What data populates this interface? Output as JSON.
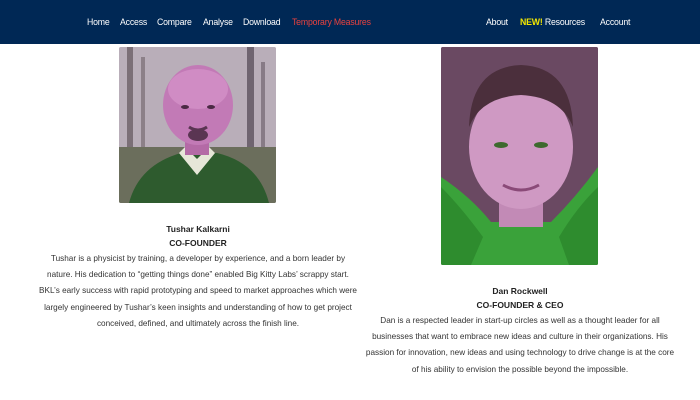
{
  "nav": {
    "left": [
      "Home",
      "Access",
      "Compare",
      "Analyse",
      "Download",
      "Temporary Measures"
    ],
    "about": "About",
    "new_badge": "NEW!",
    "resources": "Resources",
    "account": "Account"
  },
  "colors": {
    "navbar_bg": "#002855",
    "active_link": "#e8423f",
    "new_badge": "#f2e600"
  },
  "people": [
    {
      "name": "Tushar Kalkarni",
      "role": "CO-FOUNDER",
      "bio": "Tushar is a physicist by training, a developer by experience, and a born leader by nature. His dedication to “getting things done” enabled Big Kitty Labs’ scrappy start. BKL’s early success with rapid prototyping and speed to market approaches which were largely engineered by Tushar’s keen insights and understanding of how to get project conceived, defined, and ultimately across the finish line."
    },
    {
      "name": "Dan Rockwell",
      "role": "CO-FOUNDER & CEO",
      "bio": "Dan is a respected leader in start-up circles as well as a thought leader for all businesses that want to embrace new ideas and culture in their organizations. His passion for innovation, new ideas and using technology to drive change is at the core of his ability to envision the possible beyond the impossible."
    }
  ]
}
